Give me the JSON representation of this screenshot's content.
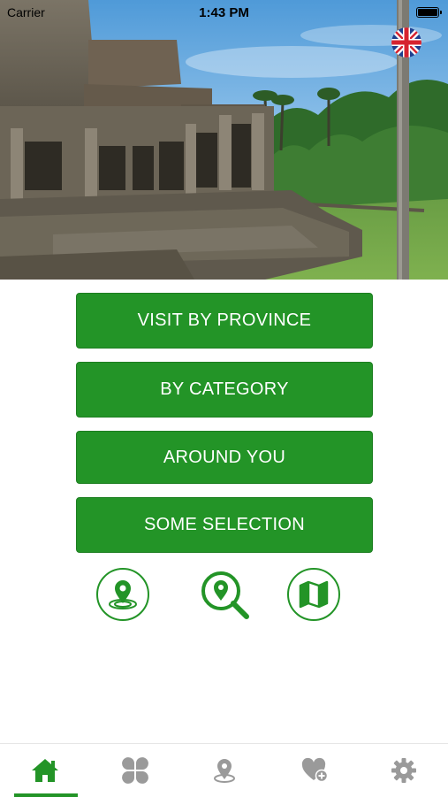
{
  "status_bar": {
    "carrier": "Carrier",
    "time": "1:43 PM"
  },
  "colors": {
    "accent": "#239427",
    "tab_inactive": "#9a9a9a"
  },
  "header": {
    "hero_image": "temple-ruins-photo",
    "language_flag": "uk-flag-icon"
  },
  "menu": {
    "items": [
      {
        "label": "VISIT BY PROVINCE"
      },
      {
        "label": "BY CATEGORY"
      },
      {
        "label": "AROUND YOU"
      },
      {
        "label": "SOME SELECTION"
      }
    ]
  },
  "quick_actions": [
    {
      "icon": "location-pin-icon"
    },
    {
      "icon": "search-location-icon"
    },
    {
      "icon": "map-icon"
    }
  ],
  "tab_bar": {
    "active_index": 0,
    "tabs": [
      {
        "icon": "home-icon"
      },
      {
        "icon": "category-icon"
      },
      {
        "icon": "location-icon"
      },
      {
        "icon": "favorite-add-icon"
      },
      {
        "icon": "gear-icon"
      }
    ]
  }
}
